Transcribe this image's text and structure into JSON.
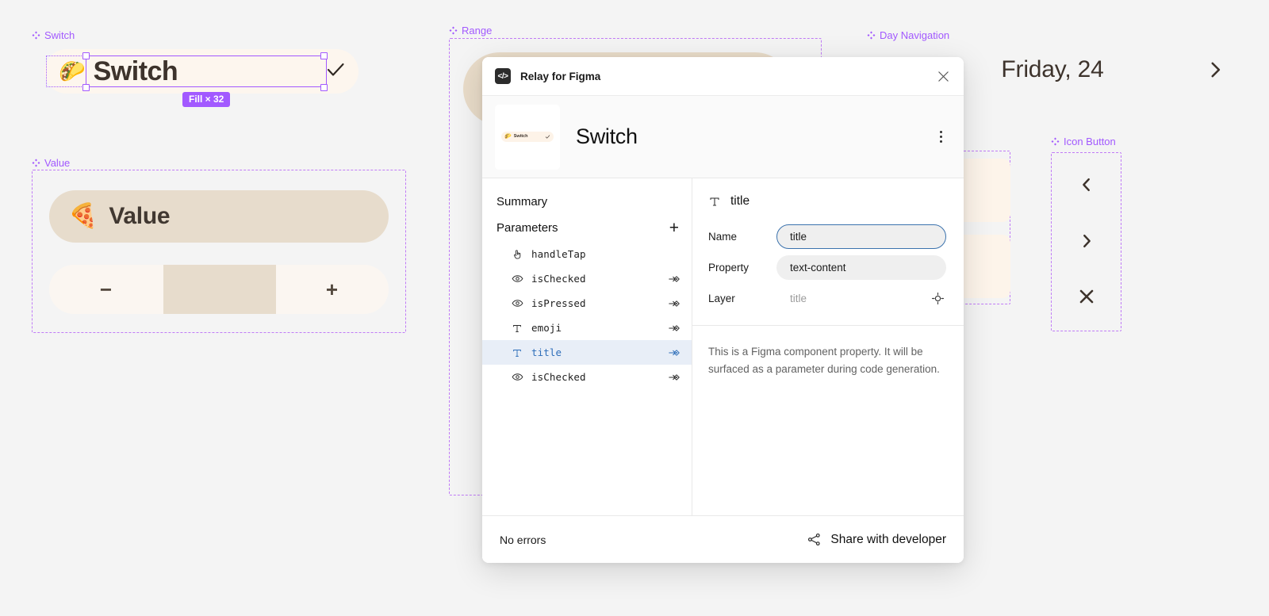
{
  "canvas": {
    "background": "#f4f4f4",
    "accent_purple": "#a259ff",
    "frames": [
      {
        "label": "Switch"
      },
      {
        "label": "Value"
      },
      {
        "label": "Range"
      },
      {
        "label": "Day Navigation"
      },
      {
        "label": "Icon Button"
      }
    ]
  },
  "switch_component": {
    "frame_label": "Switch",
    "emoji": "🌮",
    "title": "Switch",
    "check_icon": "check-icon",
    "selection_badge": "Fill × 32"
  },
  "value_component": {
    "frame_label": "Value",
    "emoji": "🍕",
    "title": "Value",
    "stepper": {
      "decrement_label": "−",
      "increment_label": "+"
    }
  },
  "range_component": {
    "frame_label": "Range"
  },
  "day_navigation": {
    "frame_label": "Day Navigation",
    "title": "Friday, 24",
    "prev_icon": "chevron-left-icon",
    "next_icon": "chevron-right-icon"
  },
  "icon_button": {
    "frame_label": "Icon Button",
    "icons": [
      {
        "name": "chevron-left-icon",
        "glyph": "‹"
      },
      {
        "name": "chevron-right-icon",
        "glyph": "›"
      },
      {
        "name": "close-icon",
        "glyph": "×"
      }
    ]
  },
  "modal": {
    "plugin_icon": "code-brackets-icon",
    "plugin_icon_text": "</>",
    "plugin_title": "Relay for Figma",
    "close_icon": "close-icon",
    "hero": {
      "component_name": "Switch",
      "thumbnail_emoji": "🌮",
      "thumbnail_label": "Switch",
      "menu_icon": "more-vertical-icon"
    },
    "left_panel": {
      "summary_label": "Summary",
      "parameters_label": "Parameters",
      "add_label": "+",
      "parameters": [
        {
          "icon": "tap-gesture-icon",
          "name": "handleTap",
          "has_arrow": false,
          "selected": false
        },
        {
          "icon": "eye-icon",
          "name": "isChecked",
          "has_arrow": true,
          "selected": false
        },
        {
          "icon": "eye-icon",
          "name": "isPressed",
          "has_arrow": true,
          "selected": false
        },
        {
          "icon": "text-type-icon",
          "name": "emoji",
          "has_arrow": true,
          "selected": false
        },
        {
          "icon": "text-type-icon",
          "name": "title",
          "has_arrow": true,
          "selected": true
        },
        {
          "icon": "eye-icon",
          "name": "isChecked",
          "has_arrow": true,
          "selected": false
        }
      ]
    },
    "right_panel": {
      "detail_icon": "text-type-icon",
      "detail_title": "title",
      "fields": [
        {
          "label": "Name",
          "value": "title",
          "style": "input-focused"
        },
        {
          "label": "Property",
          "value": "text-content",
          "style": "input"
        },
        {
          "label": "Layer",
          "value": "title",
          "style": "plain",
          "trailing_icon": "target-crosshair-icon"
        }
      ],
      "description": "This is a Figma component property. It will be surfaced as a parameter during code generation."
    },
    "footer": {
      "status": "No errors",
      "share_icon": "share-icon",
      "share_label": "Share with developer"
    }
  }
}
